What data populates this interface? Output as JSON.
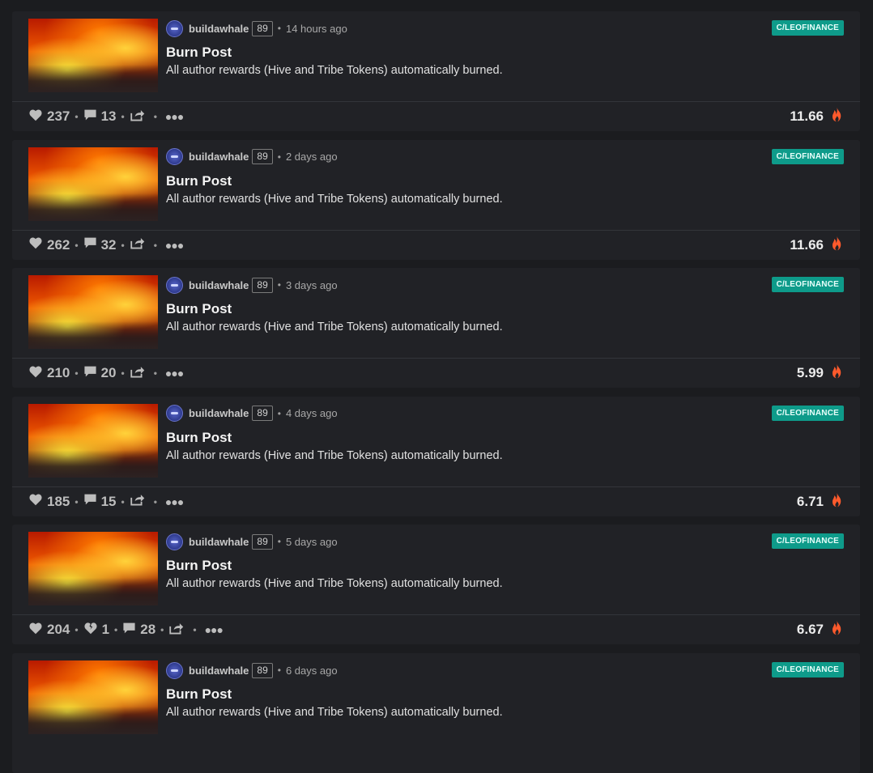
{
  "colors": {
    "background": "#1b1c1f",
    "card": "#212226",
    "tag": "#0e9b8a",
    "fire": "#ff5a2c"
  },
  "posts": [
    {
      "author": "buildawhale",
      "reputation": "89",
      "time": "14 hours ago",
      "community": "C/LEOFINANCE",
      "title": "Burn Post",
      "summary": "All author rewards (Hive and Tribe Tokens) automatically burned.",
      "votes": "237",
      "downvotes": null,
      "comments": "13",
      "payout": "11.66"
    },
    {
      "author": "buildawhale",
      "reputation": "89",
      "time": "2 days ago",
      "community": "C/LEOFINANCE",
      "title": "Burn Post",
      "summary": "All author rewards (Hive and Tribe Tokens) automatically burned.",
      "votes": "262",
      "downvotes": null,
      "comments": "32",
      "payout": "11.66"
    },
    {
      "author": "buildawhale",
      "reputation": "89",
      "time": "3 days ago",
      "community": "C/LEOFINANCE",
      "title": "Burn Post",
      "summary": "All author rewards (Hive and Tribe Tokens) automatically burned.",
      "votes": "210",
      "downvotes": null,
      "comments": "20",
      "payout": "5.99"
    },
    {
      "author": "buildawhale",
      "reputation": "89",
      "time": "4 days ago",
      "community": "C/LEOFINANCE",
      "title": "Burn Post",
      "summary": "All author rewards (Hive and Tribe Tokens) automatically burned.",
      "votes": "185",
      "downvotes": null,
      "comments": "15",
      "payout": "6.71"
    },
    {
      "author": "buildawhale",
      "reputation": "89",
      "time": "5 days ago",
      "community": "C/LEOFINANCE",
      "title": "Burn Post",
      "summary": "All author rewards (Hive and Tribe Tokens) automatically burned.",
      "votes": "204",
      "downvotes": "1",
      "comments": "28",
      "payout": "6.67"
    },
    {
      "author": "buildawhale",
      "reputation": "89",
      "time": "6 days ago",
      "community": "C/LEOFINANCE",
      "title": "Burn Post",
      "summary": "All author rewards (Hive and Tribe Tokens) automatically burned.",
      "votes": null,
      "downvotes": null,
      "comments": null,
      "payout": null
    }
  ]
}
